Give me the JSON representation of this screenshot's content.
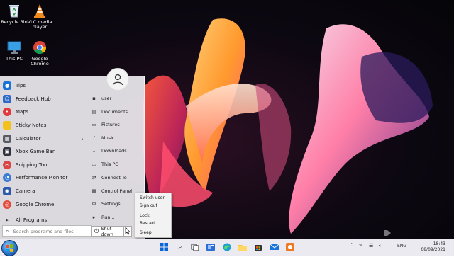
{
  "desktop": {
    "icons": [
      {
        "label": "Recycle Bin",
        "icon": "recycle-bin-icon"
      },
      {
        "label": "VLC media player",
        "icon": "vlc-cone-icon"
      },
      {
        "label": "This PC",
        "icon": "monitor-icon"
      },
      {
        "label": "Google Chrome",
        "icon": "chrome-icon"
      }
    ]
  },
  "start_menu": {
    "apps": [
      {
        "label": "Tips",
        "icon": "tips-icon",
        "color": "#1a73d9"
      },
      {
        "label": "Feedback Hub",
        "icon": "feedback-icon",
        "color": "#2d69c8"
      },
      {
        "label": "Maps",
        "icon": "maps-pin-icon",
        "color": "#e23a3a"
      },
      {
        "label": "Sticky Notes",
        "icon": "sticky-notes-icon",
        "color": "#f2c21b"
      },
      {
        "label": "Calculator",
        "icon": "calculator-icon",
        "color": "#5b5b66",
        "has_submenu": true
      },
      {
        "label": "Xbox Game Bar",
        "icon": "xbox-icon",
        "color": "#333340"
      },
      {
        "label": "Snipping Tool",
        "icon": "snipping-tool-icon",
        "color": "#d94646"
      },
      {
        "label": "Performance Monitor",
        "icon": "performance-monitor-icon",
        "color": "#3a7bd5"
      },
      {
        "label": "Camera",
        "icon": "camera-icon",
        "color": "#2b5aa8"
      },
      {
        "label": "Google Chrome",
        "icon": "chrome-icon",
        "color": "#e24a3a"
      }
    ],
    "all_programs": "All Programs",
    "search_placeholder": "Search programs and files",
    "places": [
      {
        "label": "user",
        "icon": "folder-user-icon"
      },
      {
        "label": "Documents",
        "icon": "documents-icon"
      },
      {
        "label": "Pictures",
        "icon": "pictures-icon"
      },
      {
        "label": "Music",
        "icon": "music-icon"
      },
      {
        "label": "Downloads",
        "icon": "downloads-icon"
      },
      {
        "label": "This PC",
        "icon": "this-pc-icon"
      },
      {
        "label": "Connect To",
        "icon": "connect-icon"
      },
      {
        "label": "Control Panel",
        "icon": "control-panel-icon"
      },
      {
        "label": "Settings",
        "icon": "settings-gear-icon"
      },
      {
        "label": "Run...",
        "icon": "run-icon"
      }
    ],
    "shutdown_label": "Shut down"
  },
  "power_menu": {
    "items": [
      "Switch user",
      "Sign out",
      "Lock",
      "Restart",
      "Sleep"
    ]
  },
  "taskbar": {
    "tray_lang": "ENG",
    "time": "18:43",
    "date": "08/09/2021"
  },
  "colors": {
    "accent": "#1a73d9"
  }
}
